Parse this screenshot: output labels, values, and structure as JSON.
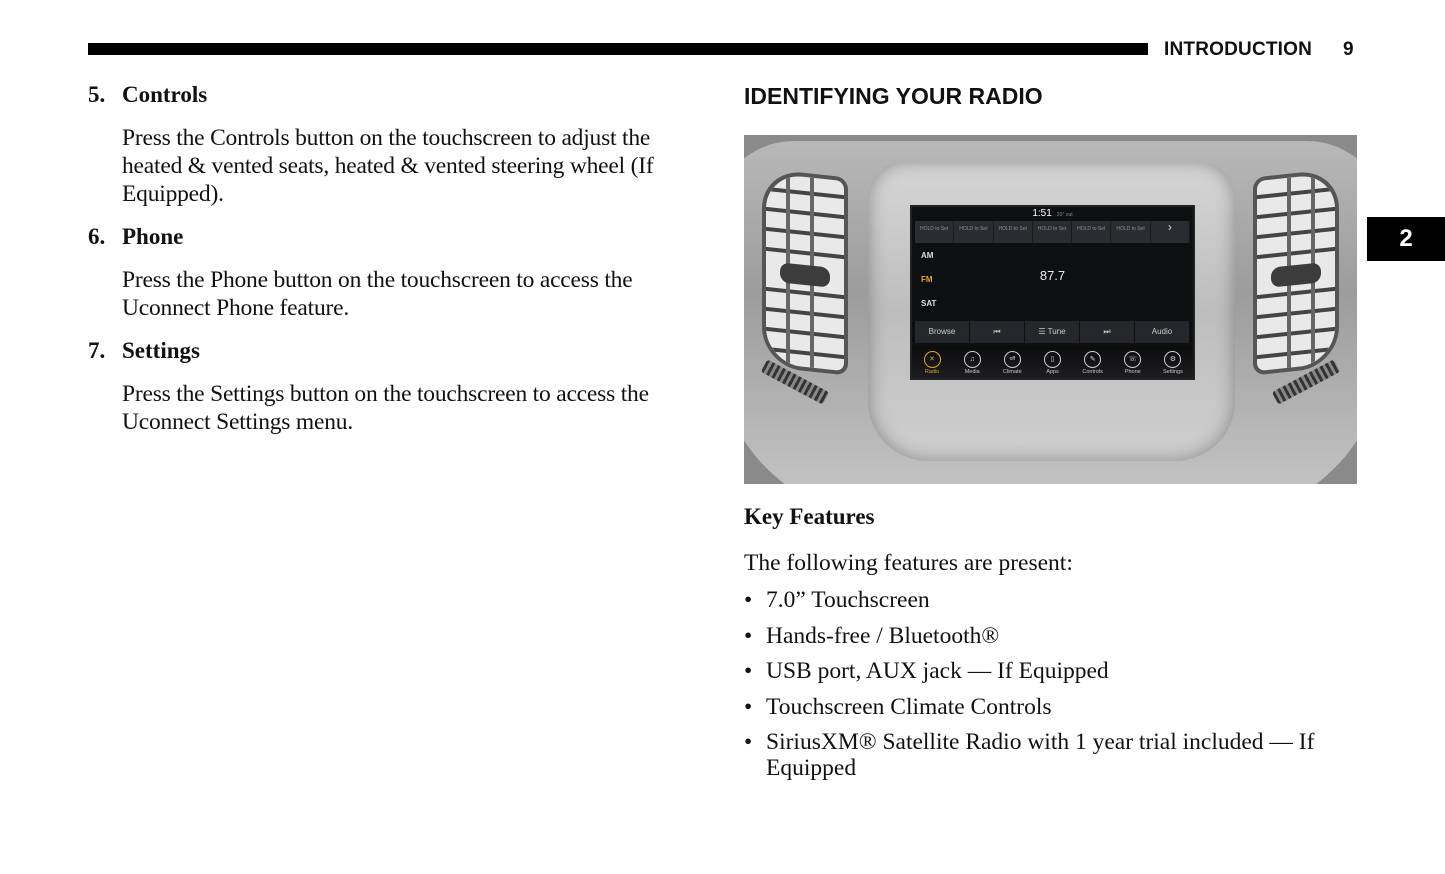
{
  "header": {
    "section": "INTRODUCTION",
    "page_number": "9",
    "chapter_tab": "2"
  },
  "left_column": {
    "items": [
      {
        "number": "5.",
        "title": "Controls",
        "body": "Press the Controls button on the touchscreen to adjust the heated & vented seats, heated & vented steering wheel (If Equipped)."
      },
      {
        "number": "6.",
        "title": "Phone",
        "body": "Press the Phone button on the touchscreen to access the Uconnect Phone feature."
      },
      {
        "number": "7.",
        "title": "Settings",
        "body": "Press the Settings button on the touchscreen to access the Uconnect Settings menu."
      }
    ]
  },
  "right_column": {
    "section_title": "IDENTIFYING YOUR RADIO",
    "radio_screen": {
      "time": "1:51",
      "temperature": "20° out",
      "presets": [
        "HOLD to Set",
        "HOLD to Set",
        "HOLD to Set",
        "HOLD to Set",
        "HOLD to Set",
        "HOLD to Set"
      ],
      "preset_next_icon": "›",
      "bands": [
        "AM",
        "FM",
        "SAT"
      ],
      "active_band": "FM",
      "frequency": "87.7",
      "controls": [
        "Browse",
        "⏮",
        "☰ Tune",
        "⏭",
        "Audio"
      ],
      "dock": [
        {
          "label": "Radio",
          "icon": "radio-icon",
          "glyph": "✕",
          "active": true
        },
        {
          "label": "Media",
          "icon": "music-note-icon",
          "glyph": "♫",
          "active": false
        },
        {
          "label": "Climate",
          "icon": "climate-icon",
          "glyph": "off",
          "active": false
        },
        {
          "label": "Apps",
          "icon": "apps-icon",
          "glyph": "▯",
          "active": false
        },
        {
          "label": "Controls",
          "icon": "wrench-icon",
          "glyph": "✎",
          "active": false
        },
        {
          "label": "Phone",
          "icon": "phone-icon",
          "glyph": "☏",
          "active": false
        },
        {
          "label": "Settings",
          "icon": "gear-icon",
          "glyph": "⚙",
          "active": false
        }
      ],
      "accent_color": "#e3a42d"
    },
    "key_features": {
      "title": "Key Features",
      "intro": "The following features are present:",
      "bullet": "•",
      "items": [
        "7.0” Touchscreen",
        "Hands-free / Bluetooth®",
        "USB port, AUX jack — If Equipped",
        "Touchscreen Climate Controls",
        "SiriusXM® Satellite Radio with 1 year trial included — If Equipped"
      ]
    }
  }
}
